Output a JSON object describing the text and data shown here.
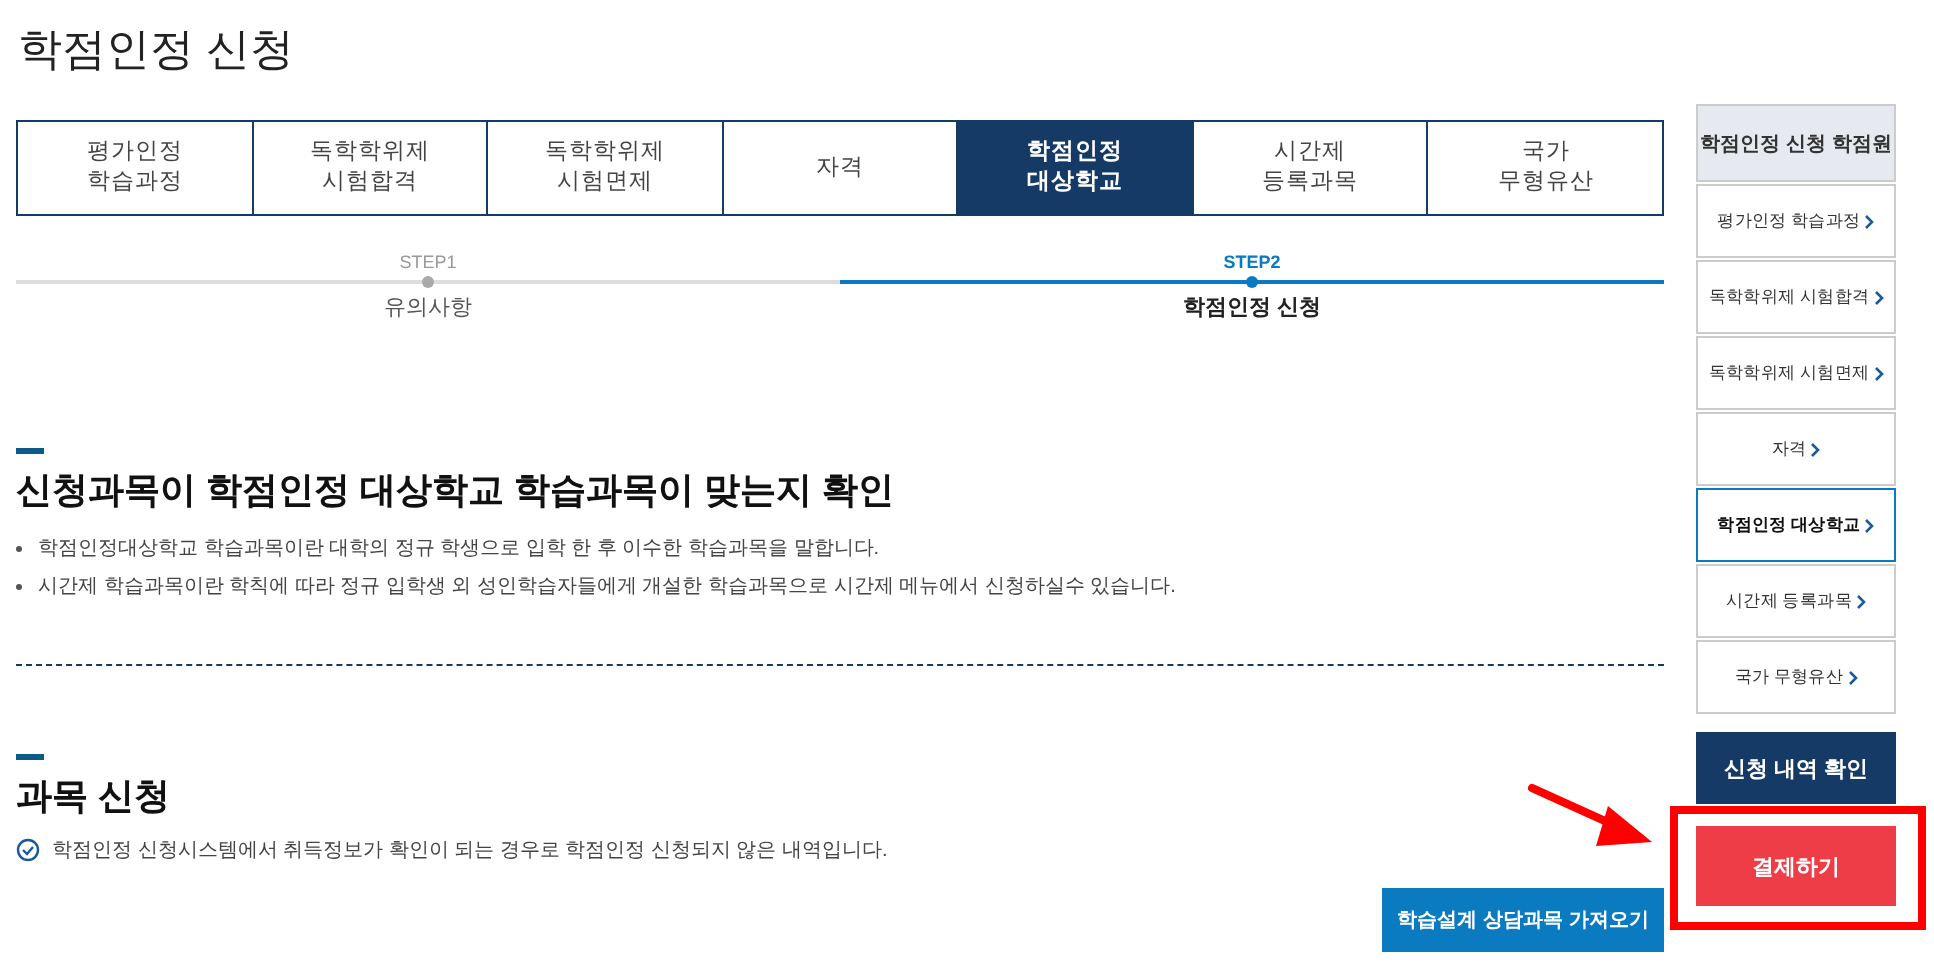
{
  "page_title": "학점인정 신청",
  "tabs": [
    {
      "lines": [
        "평가인정",
        "학습과정"
      ],
      "selected": false
    },
    {
      "lines": [
        "독학학위제",
        "시험합격"
      ],
      "selected": false
    },
    {
      "lines": [
        "독학학위제",
        "시험면제"
      ],
      "selected": false
    },
    {
      "lines": [
        "자격"
      ],
      "selected": false
    },
    {
      "lines": [
        "학점인정",
        "대상학교"
      ],
      "selected": true
    },
    {
      "lines": [
        "시간제",
        "등록과목"
      ],
      "selected": false
    },
    {
      "lines": [
        "국가",
        "무형유산"
      ],
      "selected": false
    }
  ],
  "steps": [
    {
      "step": "STEP1",
      "label": "유의사항",
      "selected": false
    },
    {
      "step": "STEP2",
      "label": "학점인정 신청",
      "selected": true
    }
  ],
  "section1": {
    "heading": "신청과목이 학점인정 대상학교 학습과목이 맞는지 확인",
    "bullets": [
      "학점인정대상학교 학습과목이란 대학의 정규 학생으로 입학 한 후 이수한 학습과목을 말합니다.",
      "시간제 학습과목이란 학칙에 따라 정규 입학생 외 성인학습자들에게 개설한 학습과목으로 시간제 메뉴에서 신청하실수 있습니다."
    ]
  },
  "section2": {
    "heading": "과목 신청",
    "notice": "학점인정 신청시스템에서 취득정보가 확인이 되는 경우로 학점인정 신청되지 않은 내역입니다.",
    "button": "학습설계 상담과목 가져오기"
  },
  "sidebar": {
    "title": "학점인정 신청 학점원",
    "items": [
      {
        "label": "평가인정 학습과정",
        "selected": false
      },
      {
        "label": "독학학위제 시험합격",
        "selected": false
      },
      {
        "label": "독학학위제 시험면제",
        "selected": false
      },
      {
        "label": "자격",
        "selected": false
      },
      {
        "label": "학점인정 대상학교",
        "selected": true
      },
      {
        "label": "시간제 등록과목",
        "selected": false
      },
      {
        "label": "국가 무형유산",
        "selected": false
      }
    ],
    "check_button": "신청 내역 확인",
    "pay_button": {
      "label": "결제하기",
      "highlighted": true
    }
  }
}
